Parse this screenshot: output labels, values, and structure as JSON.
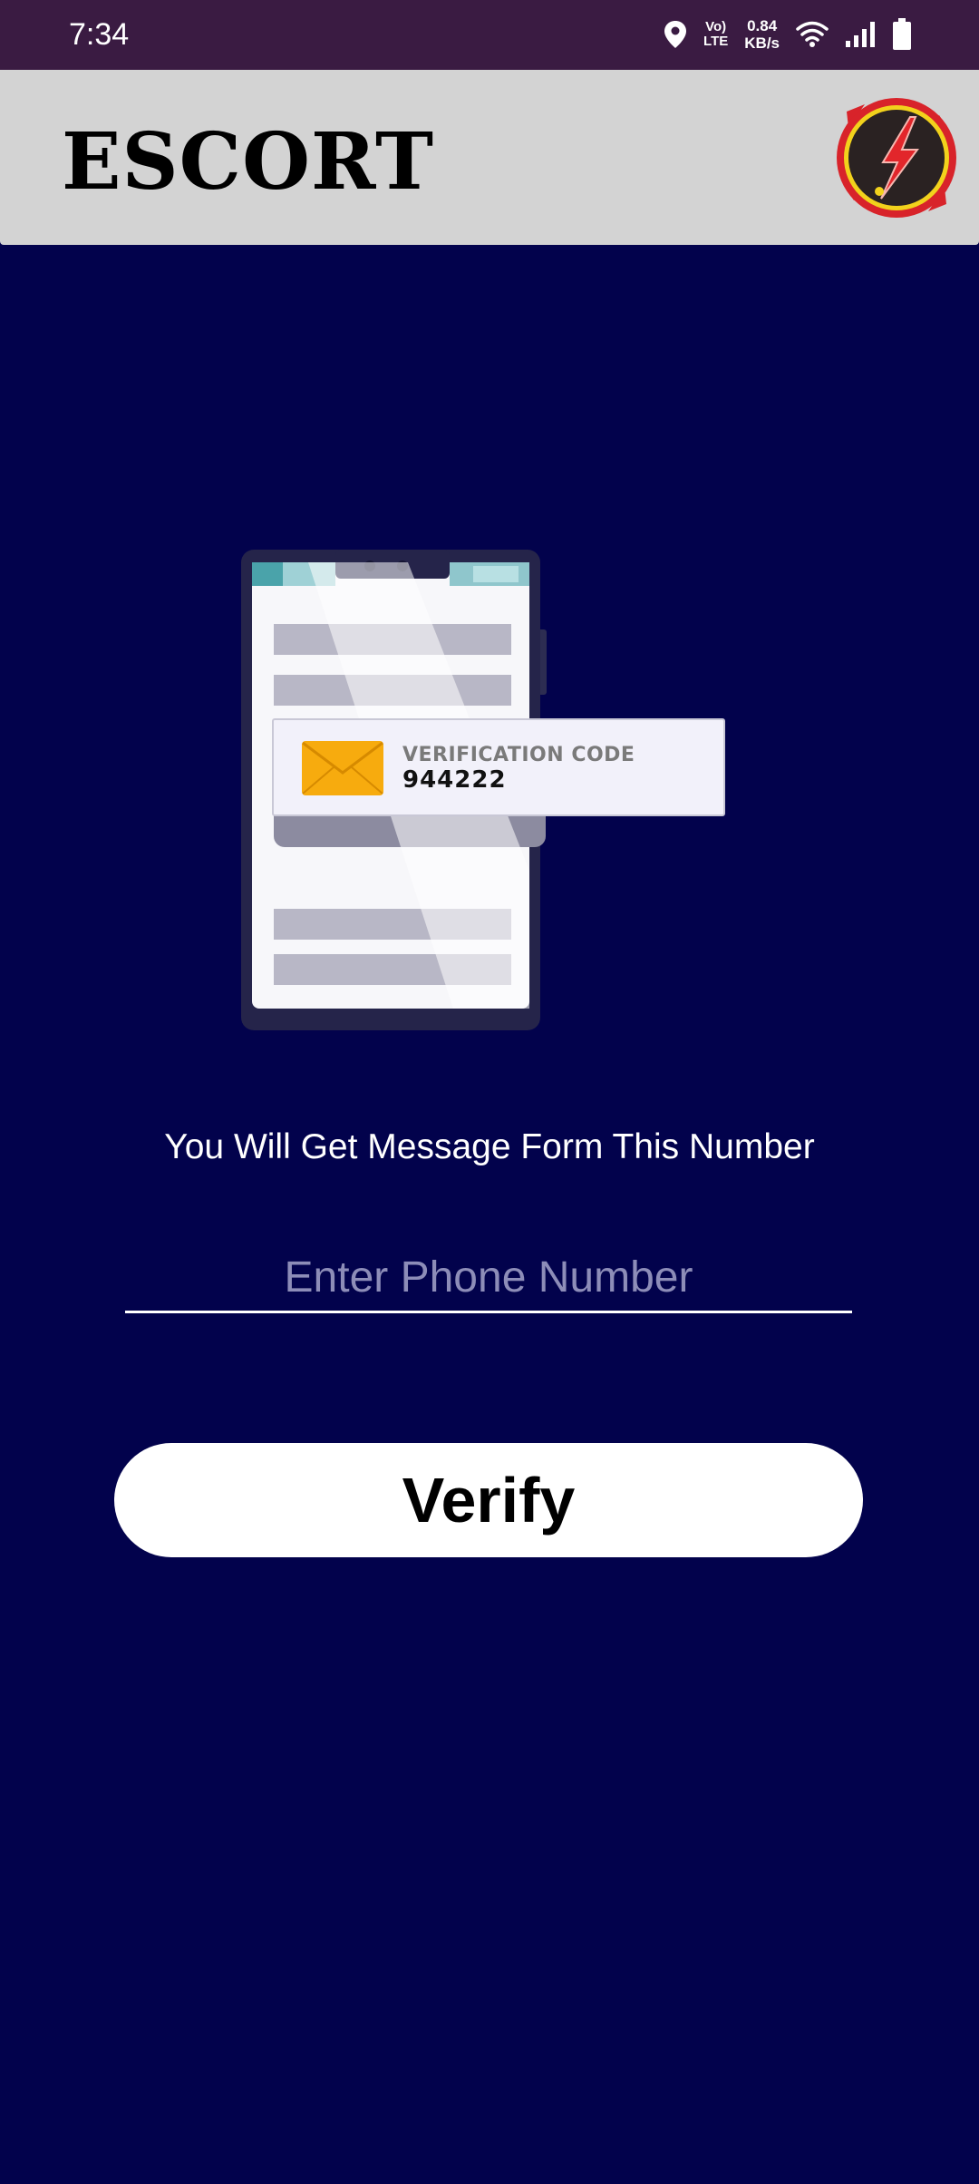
{
  "status_bar": {
    "time": "7:34",
    "lte_top": "Vo)",
    "lte_bottom": "LTE",
    "speed_value": "0.84",
    "speed_unit": "KB/s",
    "icons": [
      "location-icon",
      "volte-lte-icon",
      "wifi-icon",
      "signal-icon",
      "battery-icon"
    ]
  },
  "app_bar": {
    "title": "ESCORT",
    "logo_icon": "lightning-bolt-logo-icon"
  },
  "illustration": {
    "code_label": "VERIFICATION CODE",
    "code_value": "944222",
    "icon": "envelope-icon"
  },
  "main": {
    "info_text": "You Will Get Message Form This Number",
    "phone_placeholder": "Enter Phone Number",
    "phone_value": "",
    "verify_label": "Verify"
  },
  "colors": {
    "background": "#02024c",
    "status_bar": "#3a1b42",
    "app_bar": "#d3d3d3",
    "button": "#ffffff",
    "envelope": "#f7ab0e"
  }
}
